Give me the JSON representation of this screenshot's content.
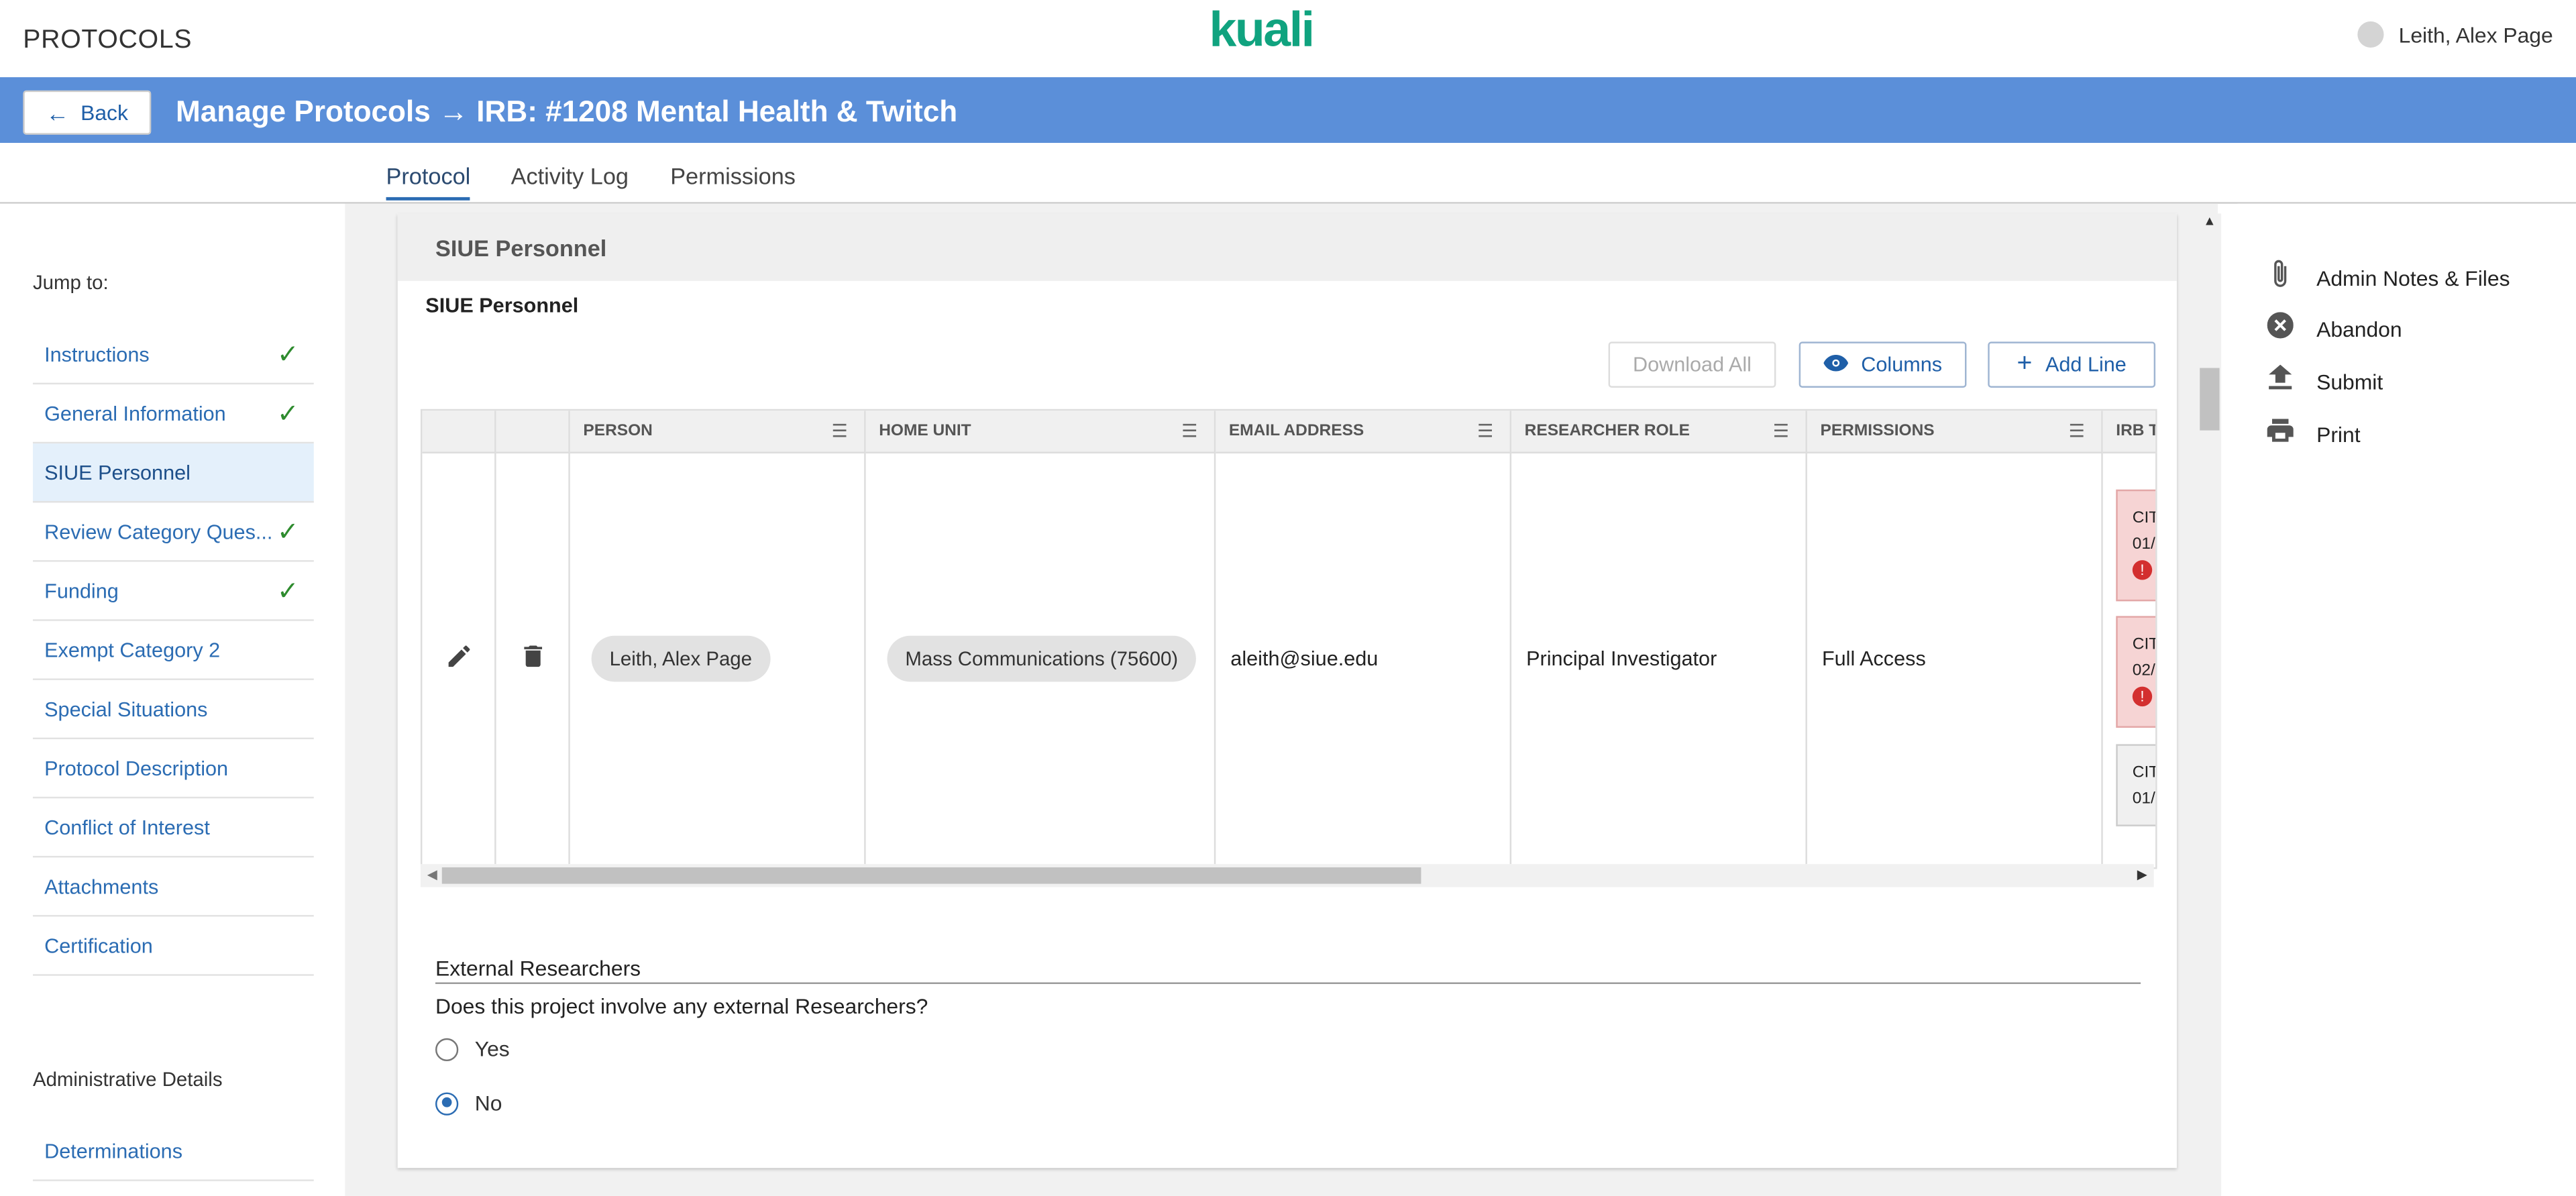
{
  "header": {
    "app_name": "PROTOCOLS",
    "logo_text": "kuali",
    "user_name": "Leith, Alex Page"
  },
  "titlebar": {
    "back_label": "Back",
    "title": "Manage Protocols → IRB: #1208 Mental Health & Twitch"
  },
  "tabs": [
    {
      "label": "Protocol",
      "active": true
    },
    {
      "label": "Activity Log",
      "active": false
    },
    {
      "label": "Permissions",
      "active": false
    }
  ],
  "sidebar": {
    "jump_label": "Jump to:",
    "items": [
      {
        "label": "Instructions",
        "complete": true
      },
      {
        "label": "General Information",
        "complete": true
      },
      {
        "label": "SIUE Personnel",
        "complete": false,
        "active": true
      },
      {
        "label": "Review Category Ques...",
        "complete": true
      },
      {
        "label": "Funding",
        "complete": true
      },
      {
        "label": "Exempt Category 2",
        "complete": false
      },
      {
        "label": "Special Situations",
        "complete": false
      },
      {
        "label": "Protocol Description",
        "complete": false
      },
      {
        "label": "Conflict of Interest",
        "complete": false
      },
      {
        "label": "Attachments",
        "complete": false
      },
      {
        "label": "Certification",
        "complete": false
      }
    ],
    "admin_title": "Administrative Details",
    "admin_items": [
      {
        "label": "Determinations"
      }
    ]
  },
  "section": {
    "header": "SIUE Personnel",
    "subtitle": "SIUE Personnel",
    "buttons": {
      "download_all": "Download All",
      "columns": "Columns",
      "add_line": "Add Line"
    },
    "table": {
      "columns": [
        "PERSON",
        "HOME UNIT",
        "EMAIL ADDRESS",
        "RESEARCHER ROLE",
        "PERMISSIONS",
        "IRB T"
      ],
      "rows": [
        {
          "person": "Leith, Alex Page",
          "home_unit": "Mass Communications (75600)",
          "email": "aleith@siue.edu",
          "role": "Principal Investigator",
          "permissions": "Full Access",
          "certs": [
            {
              "line1": "CIT",
              "line2": "01/",
              "alert": "!"
            },
            {
              "line1": "CIT",
              "line2": "02/",
              "alert": "!"
            },
            {
              "line1": "CIT",
              "line2": "01/"
            }
          ]
        }
      ]
    },
    "external": {
      "title": "External Researchers",
      "question": "Does this project involve any external Researchers?",
      "options": [
        {
          "label": "Yes",
          "selected": false
        },
        {
          "label": "No",
          "selected": true
        }
      ]
    }
  },
  "actions": [
    {
      "label": "Admin Notes & Files",
      "icon": "paperclip-icon"
    },
    {
      "label": "Abandon",
      "icon": "cancel-circle-icon"
    },
    {
      "label": "Submit",
      "icon": "upload-icon"
    },
    {
      "label": "Print",
      "icon": "printer-icon"
    }
  ],
  "colors": {
    "brand": "#10a37f",
    "titlebar": "#5b8fd9",
    "link": "#2b6cb3",
    "check": "#2e8b2e",
    "alert": "#d32f2f"
  }
}
